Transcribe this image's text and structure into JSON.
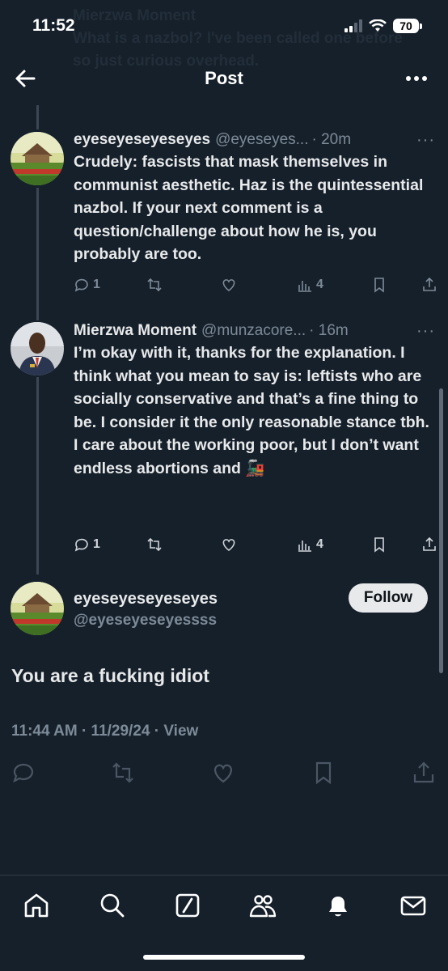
{
  "status_bar": {
    "time": "11:52",
    "battery": "70"
  },
  "background_ghost": {
    "name": "Mierzwa Moment",
    "text": "What is a nazbol? I've been called one before so just curious overhead."
  },
  "header": {
    "title": "Post"
  },
  "tweets": [
    {
      "name": "eyeseyeseyeseyes",
      "handle": "@eyeseyes...",
      "time": "· 20m",
      "more": "···",
      "body": "Crudely: fascists that mask themselves in communist aesthetic. Haz is the quintessential nazbol. If your next comment is a question/challenge about how he is, you probably are too.",
      "replies": "1",
      "reposts": "",
      "likes": "",
      "views": "4"
    },
    {
      "name": "Mierzwa Moment",
      "handle": "@munzacore...",
      "time": "· 16m",
      "more": "···",
      "body": "I’m okay with it, thanks for the explanation. I think what you mean to say is: leftists who are socially conservative and that’s a fine thing to be. I consider it the only reasonable stance tbh. I care about the working poor, but I don’t want endless abortions and 🚂",
      "replies": "1",
      "reposts": "",
      "likes": "",
      "views": "4"
    }
  ],
  "focus_tweet": {
    "name": "eyeseyeseyeseyes",
    "handle": "@eyeseyeseyessss",
    "follow_label": "Follow",
    "text": "You are a fucking idiot",
    "meta": "11:44 AM · 11/29/24 · View"
  },
  "tab_bar": {
    "items": [
      "home-icon",
      "search-icon",
      "grok-icon",
      "communities-icon",
      "notifications-icon",
      "messages-icon"
    ]
  },
  "colors": {
    "background": "#16202b",
    "text": "#e7e9ea",
    "muted": "#7d8b98"
  }
}
